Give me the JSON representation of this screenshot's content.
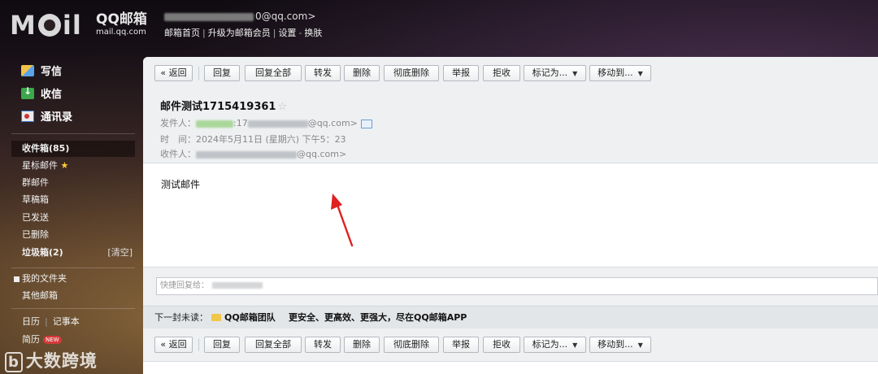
{
  "header": {
    "logo_text": "Mail",
    "brand_cn": "QQ邮箱",
    "brand_url": "mail.qq.com",
    "account_suffix": "0@qq.com>",
    "links": [
      "邮箱首页",
      "升级为邮箱会员",
      "设置",
      "换肤"
    ]
  },
  "sidebar": {
    "top": [
      {
        "label": "写信",
        "icon": "pencil-icon"
      },
      {
        "label": "收信",
        "icon": "download-icon"
      },
      {
        "label": "通讯录",
        "icon": "address-book-icon"
      }
    ],
    "folders": [
      {
        "label": "收件箱(85)"
      },
      {
        "label": "星标邮件"
      },
      {
        "label": "群邮件"
      },
      {
        "label": "草稿箱"
      },
      {
        "label": "已发送"
      },
      {
        "label": "已删除"
      },
      {
        "label": "垃圾箱(2)",
        "action": "[清空]"
      }
    ],
    "my_folders": "我的文件夹",
    "other_mailbox": "其他邮箱",
    "calendar": "日历",
    "notebook": "记事本",
    "resume": "简历",
    "new_badge": "NEW",
    "watermark": "大数跨境"
  },
  "toolbar": {
    "back": "« 返回",
    "reply": "回复",
    "reply_all": "回复全部",
    "forward": "转发",
    "delete": "删除",
    "delete_permanent": "彻底删除",
    "report": "举报",
    "reject": "拒收",
    "mark_as": "标记为...",
    "move_to": "移动到..."
  },
  "message": {
    "subject": "邮件测试1715419361",
    "star": "☆",
    "from_label": "发件人：",
    "from_partial": ":17",
    "from_suffix": "@qq.com>",
    "time_label": "时　间：",
    "time_value": "2024年5月11日 (星期六) 下午5：23",
    "to_label": "收件人：",
    "to_suffix": "@qq.com>",
    "body": "测试邮件"
  },
  "quick_reply": {
    "placeholder": "快捷回复给："
  },
  "next_mail": {
    "label": "下一封未读：",
    "from": "QQ邮箱团队",
    "subject": "更安全、更高效、更强大，尽在QQ邮箱APP"
  }
}
